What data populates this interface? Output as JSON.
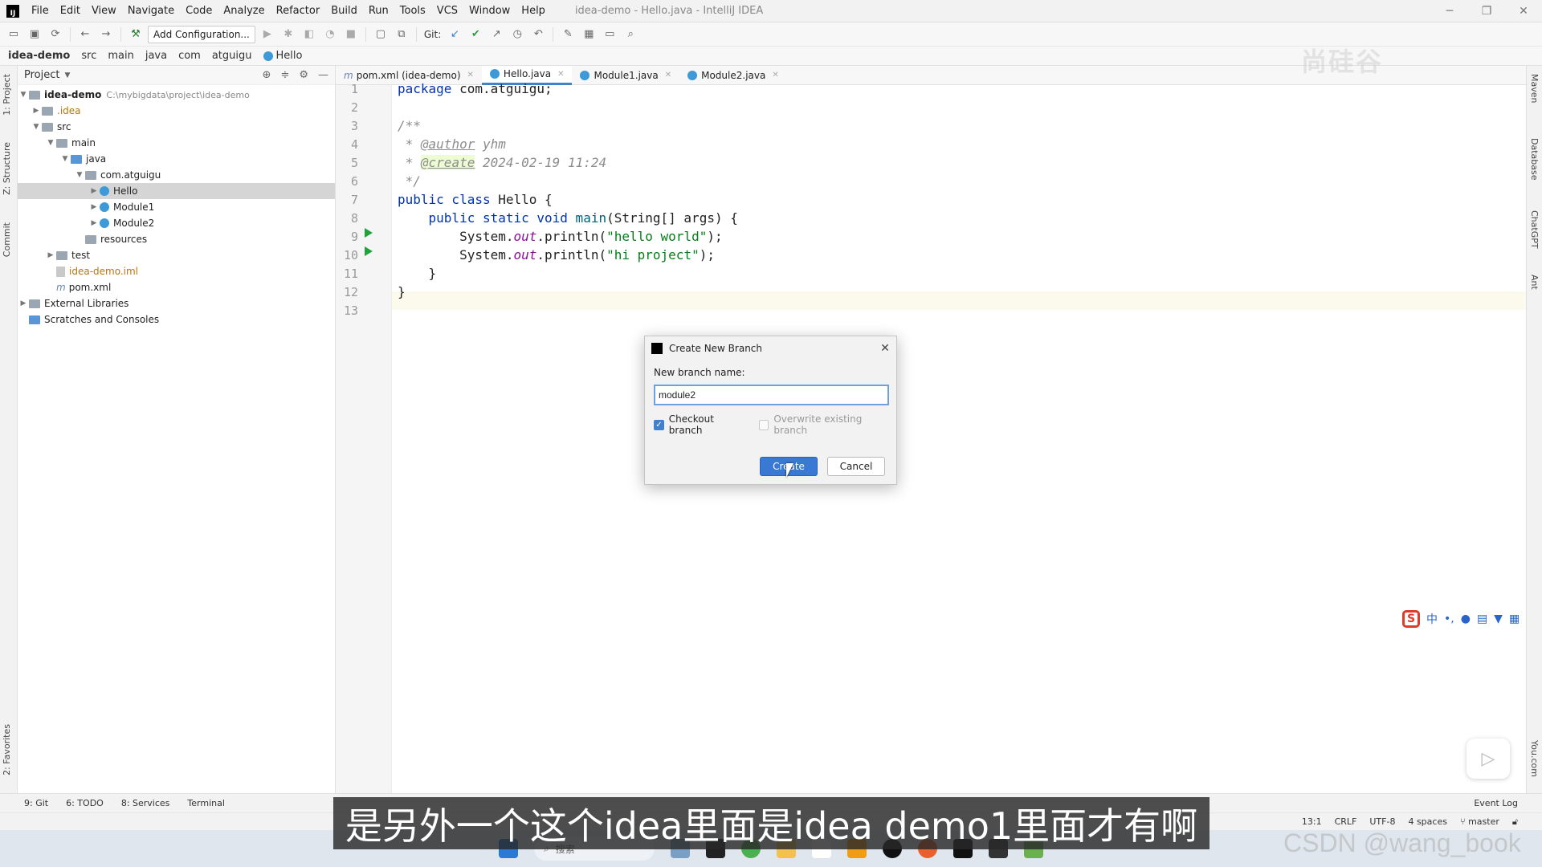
{
  "window": {
    "title": "idea-demo - Hello.java - IntelliJ IDEA",
    "controls": [
      "─",
      "❐",
      "✕"
    ]
  },
  "menu": [
    "File",
    "Edit",
    "View",
    "Navigate",
    "Code",
    "Analyze",
    "Refactor",
    "Build",
    "Run",
    "Tools",
    "VCS",
    "Window",
    "Help"
  ],
  "toolbar": {
    "add_config": "Add Configuration...",
    "git_label": "Git:"
  },
  "breadcrumb": [
    "idea-demo",
    "src",
    "main",
    "java",
    "com",
    "atguigu",
    "Hello"
  ],
  "left_tabs": [
    "1: Project",
    "Z: Structure",
    "Commit",
    "2: Favorites"
  ],
  "right_tabs": [
    "Maven",
    "Database",
    "ChatGPT",
    "Ant",
    "You.com"
  ],
  "project": {
    "header": "Project",
    "root_name": "idea-demo",
    "root_path": "C:\\mybigdata\\project\\idea-demo",
    "items": {
      "idea": ".idea",
      "src": "src",
      "main": "main",
      "java": "java",
      "pkg": "com.atguigu",
      "hello": "Hello",
      "module1": "Module1",
      "module2": "Module2",
      "resources": "resources",
      "test": "test",
      "iml": "idea-demo.iml",
      "pom": "pom.xml",
      "ext": "External Libraries",
      "scratches": "Scratches and Consoles"
    }
  },
  "tabs": [
    {
      "label": "pom.xml (idea-demo)",
      "prefix": "m"
    },
    {
      "label": "Hello.java",
      "prefix": "c"
    },
    {
      "label": "Module1.java",
      "prefix": "c"
    },
    {
      "label": "Module2.java",
      "prefix": "c"
    }
  ],
  "code": {
    "line_numbers": [
      "1",
      "2",
      "3",
      "4",
      "5",
      "6",
      "7",
      "8",
      "9",
      "10",
      "11",
      "12",
      "13"
    ],
    "l1_kw": "package",
    "l1_rest": " com.atguigu;",
    "l3": "/**",
    "l4_star": " * ",
    "l4_tag": "@author",
    "l4_val": " yhm",
    "l5_star": " * ",
    "l5_tag": "@create",
    "l5_val": " 2024-02-19 11:24",
    "l6": " */",
    "l7_kw": "public class",
    "l7_rest": " Hello {",
    "l8_kw": "    public static void",
    "l8_fn": " main",
    "l8_rest": "(String[] args) {",
    "l9_a": "        System.",
    "l9_fld": "out",
    "l9_b": ".println(",
    "l9_str": "\"hello world\"",
    "l9_c": ");",
    "l10_a": "        System.",
    "l10_fld": "out",
    "l10_b": ".println(",
    "l10_str": "\"hi project\"",
    "l10_c": ");",
    "l11": "    }",
    "l12": "}"
  },
  "dialog": {
    "title": "Create New Branch",
    "label": "New branch name:",
    "value": "module2",
    "checkout_label": "Checkout branch",
    "overwrite_label": "Overwrite existing branch",
    "checkout_checked": true,
    "overwrite_checked": false,
    "create": "Create",
    "cancel": "Cancel"
  },
  "tool_windows": [
    "9: Git",
    "6: TODO",
    "8: Services",
    "Terminal"
  ],
  "event_log": "Event Log",
  "status": {
    "position": "13:1",
    "line_sep": "CRLF",
    "encoding": "UTF-8",
    "indent": "4 spaces",
    "branch": "master"
  },
  "taskbar": {
    "search": "搜索"
  },
  "overlay": {
    "subtitle": "是另外一个这个idea里面是idea demo1里面才有啊",
    "watermark_top": "尚硅谷",
    "watermark_bottom": "CSDN @wang_book",
    "ime_logo": "S",
    "ime_lang": "中"
  },
  "colors": {
    "accent": "#3978d3",
    "keyword": "#0033b3",
    "string": "#067d17",
    "comment": "#8c8c8c",
    "run_marker": "#21a33c"
  }
}
